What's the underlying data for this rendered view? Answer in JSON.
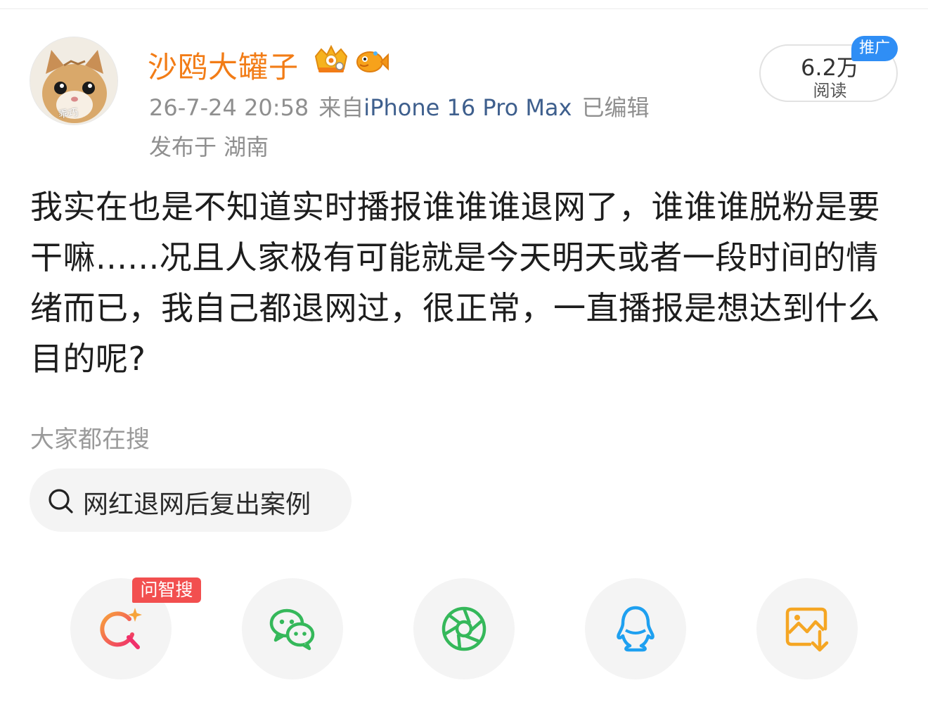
{
  "colors": {
    "username": "#f27c16",
    "device_link": "#3e5f8d",
    "meta_gray": "#8f8f8f",
    "promo_blue": "#2f8ef5",
    "ask_red": "#f24f4f"
  },
  "post": {
    "author": {
      "name": "沙鸥大罐子",
      "avatar_caption": "乖巧",
      "badges": [
        "crown-badge-icon",
        "fish-badge-icon"
      ]
    },
    "meta": {
      "time": "26-7-24 20:58",
      "source_prefix": "来自",
      "device": "iPhone 16 Pro Max",
      "edited": "已编辑",
      "location": "发布于 湖南"
    },
    "reads": {
      "count": "6.2万",
      "label": "阅读",
      "promo_tag": "推广"
    },
    "body": "我实在也是不知道实时播报谁谁谁退网了，谁谁谁脱粉是要干嘛......况且人家极有可能就是今天明天或者一段时间的情绪而已，我自己都退网过，很正常，一直播报是想达到什么目的呢?"
  },
  "search_section": {
    "title": "大家都在搜",
    "chip": "网红退网后复出案例",
    "icon": "search-icon"
  },
  "share_bar": {
    "ask_tag": "问智搜",
    "buttons": [
      {
        "icon": "ai-search-icon",
        "color": "#f2455a"
      },
      {
        "icon": "wechat-icon",
        "color": "#35b85a"
      },
      {
        "icon": "moments-icon",
        "color": "#35b85a"
      },
      {
        "icon": "qq-icon",
        "color": "#1ea0f0"
      },
      {
        "icon": "save-image-icon",
        "color": "#f5a623"
      }
    ]
  }
}
